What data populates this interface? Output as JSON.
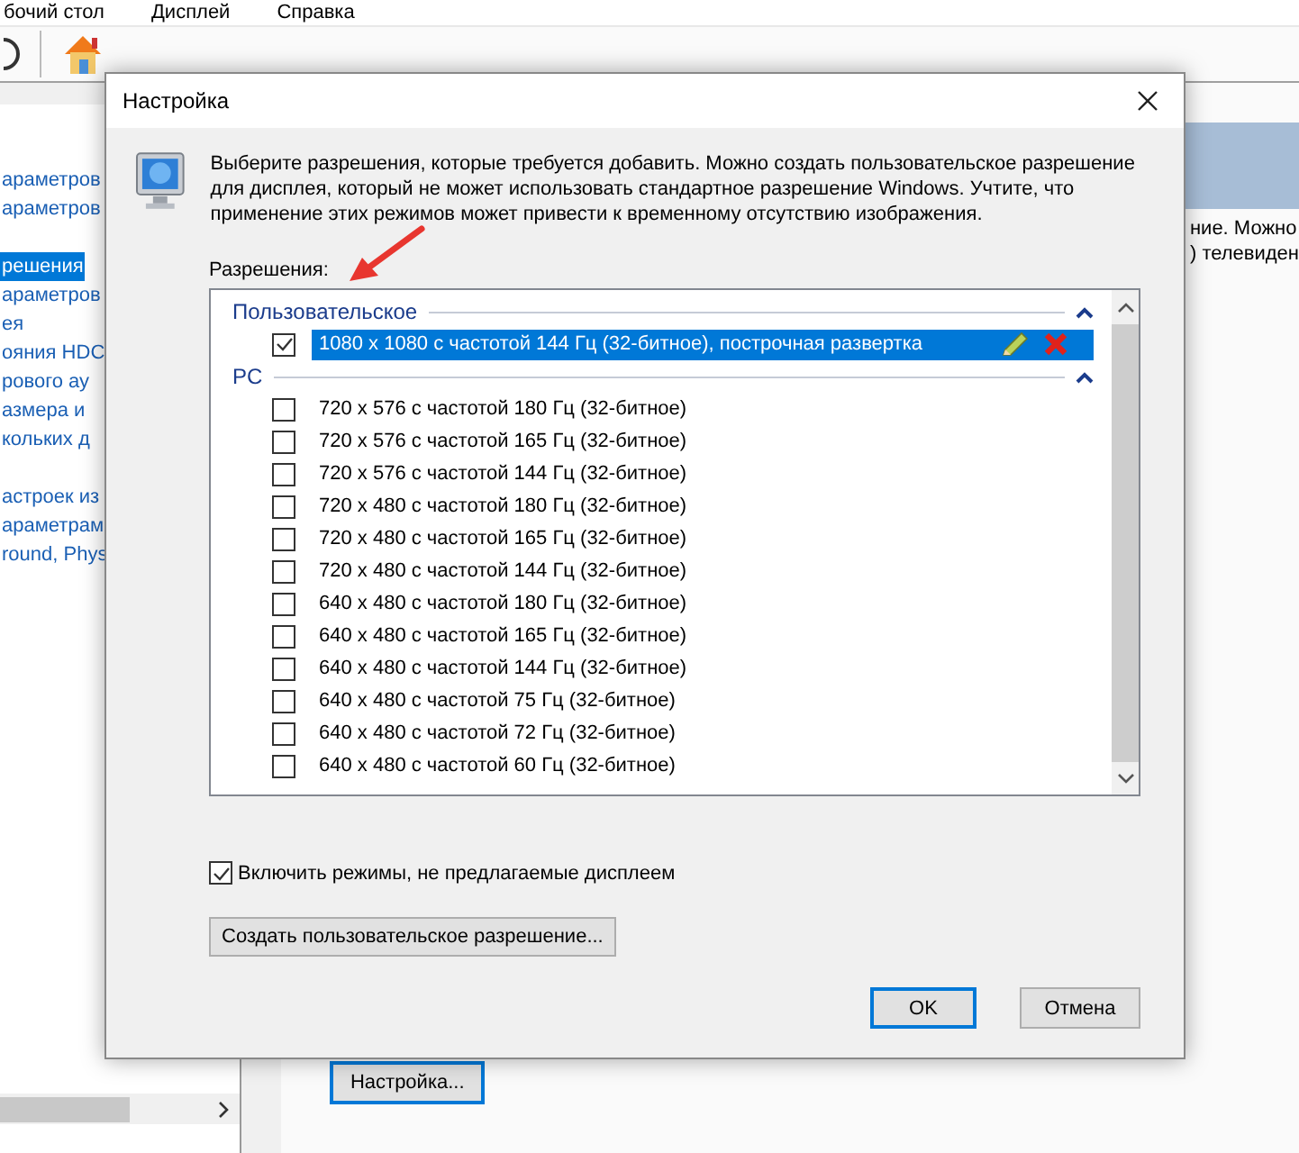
{
  "background_window": {
    "menu": [
      "бочий стол",
      "Дисплей",
      "Справка"
    ],
    "sidebar": {
      "sections": [
        {
          "items": [
            {
              "label": "араметров",
              "selected": false
            },
            {
              "label": "араметров",
              "selected": false
            }
          ]
        },
        {
          "items": [
            {
              "label": "решения",
              "selected": true
            },
            {
              "label": "араметров",
              "selected": false
            },
            {
              "label": "ея",
              "selected": false
            },
            {
              "label": "ояния HDC",
              "selected": false
            },
            {
              "label": "рового ау",
              "selected": false
            },
            {
              "label": "азмера и",
              "selected": false
            },
            {
              "label": "кольких д",
              "selected": false
            }
          ]
        },
        {
          "items": [
            {
              "label": "астроек из",
              "selected": false
            },
            {
              "label": "араметрам",
              "selected": false
            },
            {
              "label": "round, Phys",
              "selected": false
            }
          ]
        }
      ]
    },
    "content_lines": [
      "ние. Можно",
      ") телевиден"
    ],
    "button": "Настройка..."
  },
  "dialog": {
    "title": "Настройка",
    "description": "Выберите разрешения, которые требуется добавить. Можно создать пользовательское разрешение для дисплея, который не может использовать стандартное разрешение Windows. Учтите, что применение этих режимов может привести к временному отсутствию изображения.",
    "list_label": "Разрешения:",
    "groups": [
      {
        "name": "Пользовательское",
        "expanded": true,
        "items": [
          {
            "label": "1080 x 1080 с частотой 144 Гц (32-битное), построчная развертка",
            "checked": true,
            "selected": true,
            "kind": "custom"
          }
        ]
      },
      {
        "name": "PC",
        "expanded": true,
        "items": [
          {
            "label": "720 x 576 с частотой 180 Гц (32-битное)",
            "checked": false,
            "selected": false,
            "kind": "standard"
          },
          {
            "label": "720 x 576 с частотой 165 Гц (32-битное)",
            "checked": false,
            "selected": false,
            "kind": "standard"
          },
          {
            "label": "720 x 576 с частотой 144 Гц (32-битное)",
            "checked": false,
            "selected": false,
            "kind": "standard"
          },
          {
            "label": "720 x 480 с частотой 180 Гц (32-битное)",
            "checked": false,
            "selected": false,
            "kind": "standard"
          },
          {
            "label": "720 x 480 с частотой 165 Гц (32-битное)",
            "checked": false,
            "selected": false,
            "kind": "standard"
          },
          {
            "label": "720 x 480 с частотой 144 Гц (32-битное)",
            "checked": false,
            "selected": false,
            "kind": "standard"
          },
          {
            "label": "640 x 480 с частотой 180 Гц (32-битное)",
            "checked": false,
            "selected": false,
            "kind": "standard"
          },
          {
            "label": "640 x 480 с частотой 165 Гц (32-битное)",
            "checked": false,
            "selected": false,
            "kind": "standard"
          },
          {
            "label": "640 x 480 с частотой 144 Гц (32-битное)",
            "checked": false,
            "selected": false,
            "kind": "standard"
          },
          {
            "label": "640 x 480 с частотой 75 Гц (32-битное)",
            "checked": false,
            "selected": false,
            "kind": "standard"
          },
          {
            "label": "640 x 480 с частотой 72 Гц (32-битное)",
            "checked": false,
            "selected": false,
            "kind": "standard"
          },
          {
            "label": "640 x 480 с частотой 60 Гц (32-битное)",
            "checked": false,
            "selected": false,
            "kind": "standard"
          }
        ]
      }
    ],
    "include_modes": {
      "label": "Включить режимы, не предлагаемые дисплеем",
      "checked": true
    },
    "create_button": "Создать пользовательское разрешение...",
    "buttons": [
      {
        "label": "OK",
        "default": true
      },
      {
        "label": "Отмена",
        "default": false
      }
    ]
  }
}
